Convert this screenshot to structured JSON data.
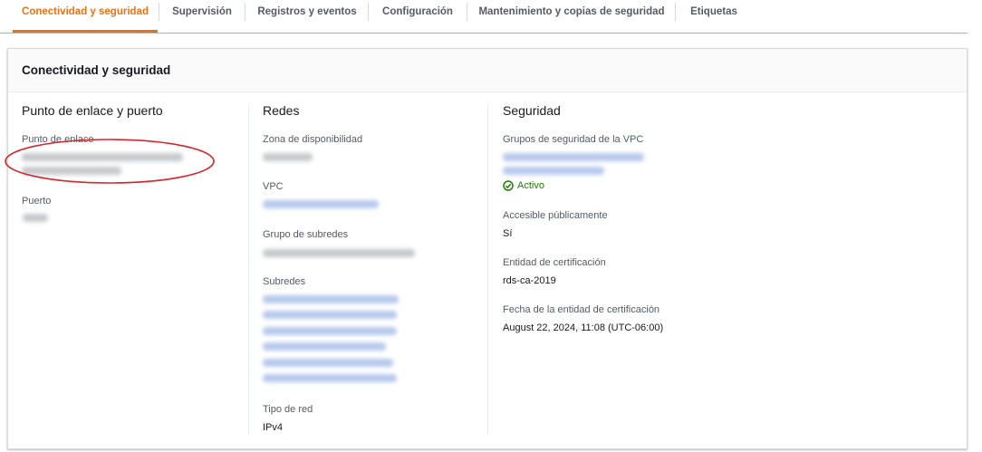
{
  "tabs": [
    {
      "label": "Conectividad y seguridad",
      "active": true
    },
    {
      "label": "Supervisión",
      "active": false
    },
    {
      "label": "Registros y eventos",
      "active": false
    },
    {
      "label": "Configuración",
      "active": false
    },
    {
      "label": "Mantenimiento y copias de seguridad",
      "active": false
    },
    {
      "label": "Etiquetas",
      "active": false
    }
  ],
  "panel": {
    "title": "Conectividad y seguridad",
    "endpoint_column": {
      "heading": "Punto de enlace y puerto",
      "endpoint_label": "Punto de enlace",
      "port_label": "Puerto"
    },
    "network_column": {
      "heading": "Redes",
      "az_label": "Zona de disponibilidad",
      "vpc_label": "VPC",
      "subnet_group_label": "Grupo de subredes",
      "subnets_label": "Subredes",
      "network_type_label": "Tipo de red",
      "network_type_value": "IPv4"
    },
    "security_column": {
      "heading": "Seguridad",
      "vpc_sg_label": "Grupos de seguridad de la VPC",
      "sg_status": "Activo",
      "public_label": "Accesible públicamente",
      "public_value": "Sí",
      "ca_label": "Entidad de certificación",
      "ca_value": "rds-ca-2019",
      "ca_date_label": "Fecha de la entidad de certificación",
      "ca_date_value": "August 22, 2024, 11:08 (UTC-06:00)"
    }
  },
  "colors": {
    "accent": "#ec7211",
    "link": "#0073bb",
    "success": "#1d8102",
    "annotation": "#d6262c"
  }
}
